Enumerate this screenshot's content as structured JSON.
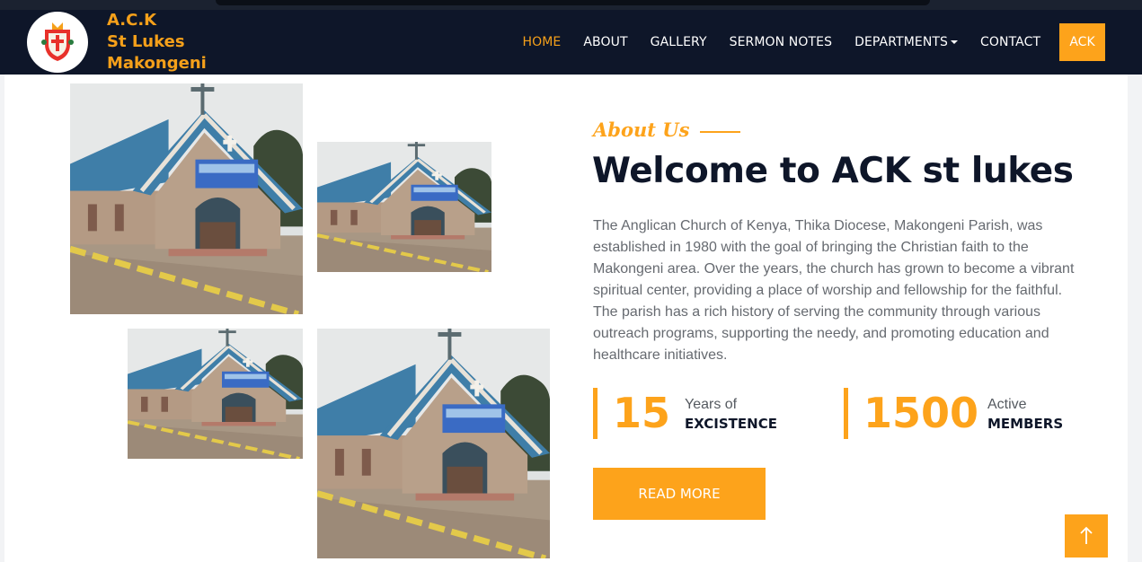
{
  "brand": {
    "line1": "A.C.K",
    "line2": "St Lukes",
    "line3": "Makongeni",
    "logo_icon": "church-crest-icon"
  },
  "nav": {
    "items": [
      {
        "label": "HOME",
        "active": true
      },
      {
        "label": "ABOUT",
        "active": false
      },
      {
        "label": "GALLERY",
        "active": false
      },
      {
        "label": "SERMON NOTES",
        "active": false
      },
      {
        "label": "DEPARTMENTS",
        "active": false,
        "dropdown": true
      },
      {
        "label": "CONTACT",
        "active": false
      }
    ],
    "cta_label": "ACK"
  },
  "about": {
    "subtitle": "About Us",
    "title": "Welcome to ACK st lukes",
    "paragraph": "The Anglican Church of Kenya, Thika Diocese, Makongeni Parish, was established in 1980 with the goal of bringing the Christian faith to the Makongeni area. Over the years, the church has grown to become a vibrant spiritual center, providing a place of worship and fellowship for the faithful. The parish has a rich history of serving the community through various outreach programs, supporting the needy, and promoting education and healthcare initiatives.",
    "stats": [
      {
        "number": "15",
        "label_top": "Years of",
        "label_bottom": "EXCISTENCE"
      },
      {
        "number": "1500",
        "label_top": "Active",
        "label_bottom": "MEMBERS"
      }
    ],
    "read_more_label": "READ MORE"
  },
  "images": [
    "church-photo",
    "church-photo",
    "church-photo",
    "church-photo"
  ],
  "back_to_top_icon": "arrow-up-icon",
  "colors": {
    "accent": "#fda31b",
    "navbar": "#0e1629",
    "text": "#666a70",
    "heading": "#0e1629"
  }
}
